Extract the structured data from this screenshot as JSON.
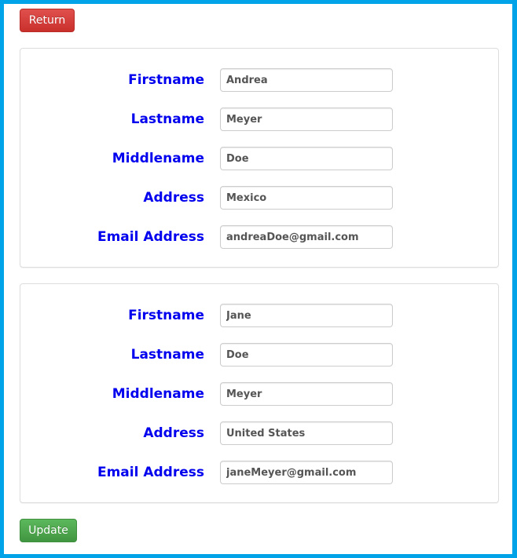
{
  "toolbar": {
    "return_label": "Return",
    "update_label": "Update"
  },
  "colors": {
    "frame_border": "#00a3e8",
    "label_color": "#0000ee",
    "return_button": "#d9534f",
    "update_button": "#5cb85c"
  },
  "records": [
    {
      "fields": [
        {
          "label": "Firstname",
          "value": "Andrea"
        },
        {
          "label": "Lastname",
          "value": "Meyer"
        },
        {
          "label": "Middlename",
          "value": "Doe"
        },
        {
          "label": "Address",
          "value": "Mexico"
        },
        {
          "label": "Email Address",
          "value": "andreaDoe@gmail.com"
        }
      ]
    },
    {
      "fields": [
        {
          "label": "Firstname",
          "value": "Jane"
        },
        {
          "label": "Lastname",
          "value": "Doe"
        },
        {
          "label": "Middlename",
          "value": "Meyer"
        },
        {
          "label": "Address",
          "value": "United States"
        },
        {
          "label": "Email Address",
          "value": "janeMeyer@gmail.com"
        }
      ]
    }
  ]
}
